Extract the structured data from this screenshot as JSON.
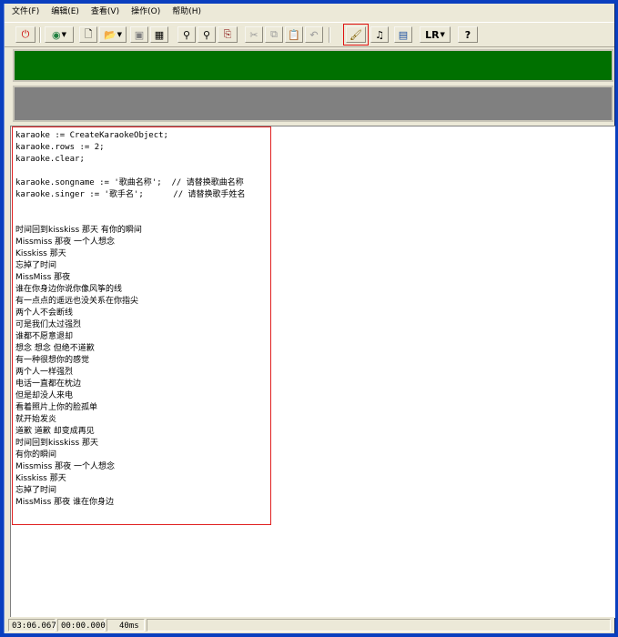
{
  "menu": [
    "文件(F)",
    "编辑(E)",
    "查看(V)",
    "操作(O)",
    "帮助(H)"
  ],
  "toolbar": {
    "buttons": [
      {
        "name": "stop-red-button",
        "glyph": "⏻",
        "color": "#cc0000"
      },
      {
        "name": "web-globe-button",
        "glyph": "◉",
        "color": "#208040"
      },
      {
        "name": "new-file-button",
        "glyph": "🗋",
        "color": "#000000"
      },
      {
        "name": "open-folder-button",
        "glyph": "📂",
        "color": "#c08000"
      },
      {
        "name": "save-button",
        "glyph": "▣",
        "color": "#808080"
      },
      {
        "name": "save-all-button",
        "glyph": "▦",
        "color": "#000000"
      },
      {
        "name": "find-button",
        "glyph": "⚲",
        "color": "#000000"
      },
      {
        "name": "find-next-button",
        "glyph": "⚲",
        "color": "#000000"
      },
      {
        "name": "replace-button",
        "glyph": "⎘",
        "color": "#800000"
      },
      {
        "name": "cut-button",
        "glyph": "✂",
        "color": "#999999"
      },
      {
        "name": "copy-button",
        "glyph": "⧉",
        "color": "#999999"
      },
      {
        "name": "paste-button",
        "glyph": "📋",
        "color": "#000000"
      },
      {
        "name": "undo-button",
        "glyph": "↶",
        "color": "#999999"
      },
      {
        "name": "run-script-button",
        "glyph": "🖌",
        "color": "#806000"
      },
      {
        "name": "karaoke-singer-button",
        "glyph": "♫",
        "color": "#000000"
      },
      {
        "name": "preview-display-button",
        "glyph": "▤",
        "color": "#1a4fa0"
      },
      {
        "name": "lr-channel-button",
        "label": "LR"
      },
      {
        "name": "help-button",
        "glyph": "?",
        "color": "#000000"
      }
    ]
  },
  "code_lines": [
    "karaoke := CreateKaraokeObject;",
    "karaoke.rows := 2;",
    "karaoke.clear;",
    "",
    "karaoke.songname := '歌曲名称';  // 请替换歌曲名称",
    "karaoke.singer := '歌手名';      // 请替换歌手姓名",
    "",
    "",
    "时间回到kisskiss 那天 有你的瞬间",
    "Missmiss 那夜 一个人想念",
    "Kisskiss 那天",
    "忘掉了时间",
    "MissMiss 那夜",
    "谁在你身边你说你像风筝的线",
    "有一点点的遥远也没关系在你指尖",
    "两个人不会断线",
    "可是我们太过强烈",
    "谁都不愿意退却",
    "想念 想念 但绝不道歉",
    "有一种很想你的感觉",
    "两个人一样强烈",
    "电话一直都在枕边",
    "但是却没人来电",
    "看着照片上你的脸孤单",
    "就开始发炎",
    "道歉 道歉 却变成再见",
    "时间回到kisskiss 那天",
    "有你的瞬间",
    "Missmiss 那夜 一个人想念",
    "Kisskiss 那天",
    "忘掉了时间",
    "MissMiss 那夜 谁在你身边"
  ],
  "status": {
    "time": "03:06.067",
    "position": "00:00.000",
    "interval": "40ms"
  }
}
